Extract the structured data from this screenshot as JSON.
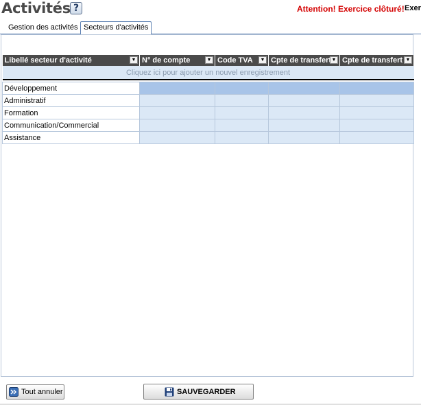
{
  "header": {
    "title": "Activités",
    "help_icon": "?",
    "warning": "Attention! Exercice clôturé!",
    "warning_extra": "Exer"
  },
  "tabs": [
    {
      "label": "Gestion des activités",
      "active": false
    },
    {
      "label": "Secteurs d'activités",
      "active": true
    }
  ],
  "grid": {
    "columns": [
      "Libellé secteur d'activité",
      "N° de compte",
      "Code TVA",
      "Cpte de transfert",
      "Cpte de transfert"
    ],
    "add_row_text": "Cliquez ici pour ajouter un nouvel enregistrement",
    "rows": [
      {
        "label": "Développement",
        "selected": true
      },
      {
        "label": "Administratif",
        "selected": false
      },
      {
        "label": "Formation",
        "selected": false
      },
      {
        "label": "Communication/Commercial",
        "selected": false
      },
      {
        "label": "Assistance",
        "selected": false
      }
    ]
  },
  "buttons": {
    "cancel_label": "Tout annuler",
    "save_label": "SAUVEGARDER"
  },
  "colors": {
    "header_bg": "#4a4a4a",
    "row_bg": "#dbe8f6",
    "selected_bg": "#a8c4e8",
    "warning": "#d40000"
  }
}
